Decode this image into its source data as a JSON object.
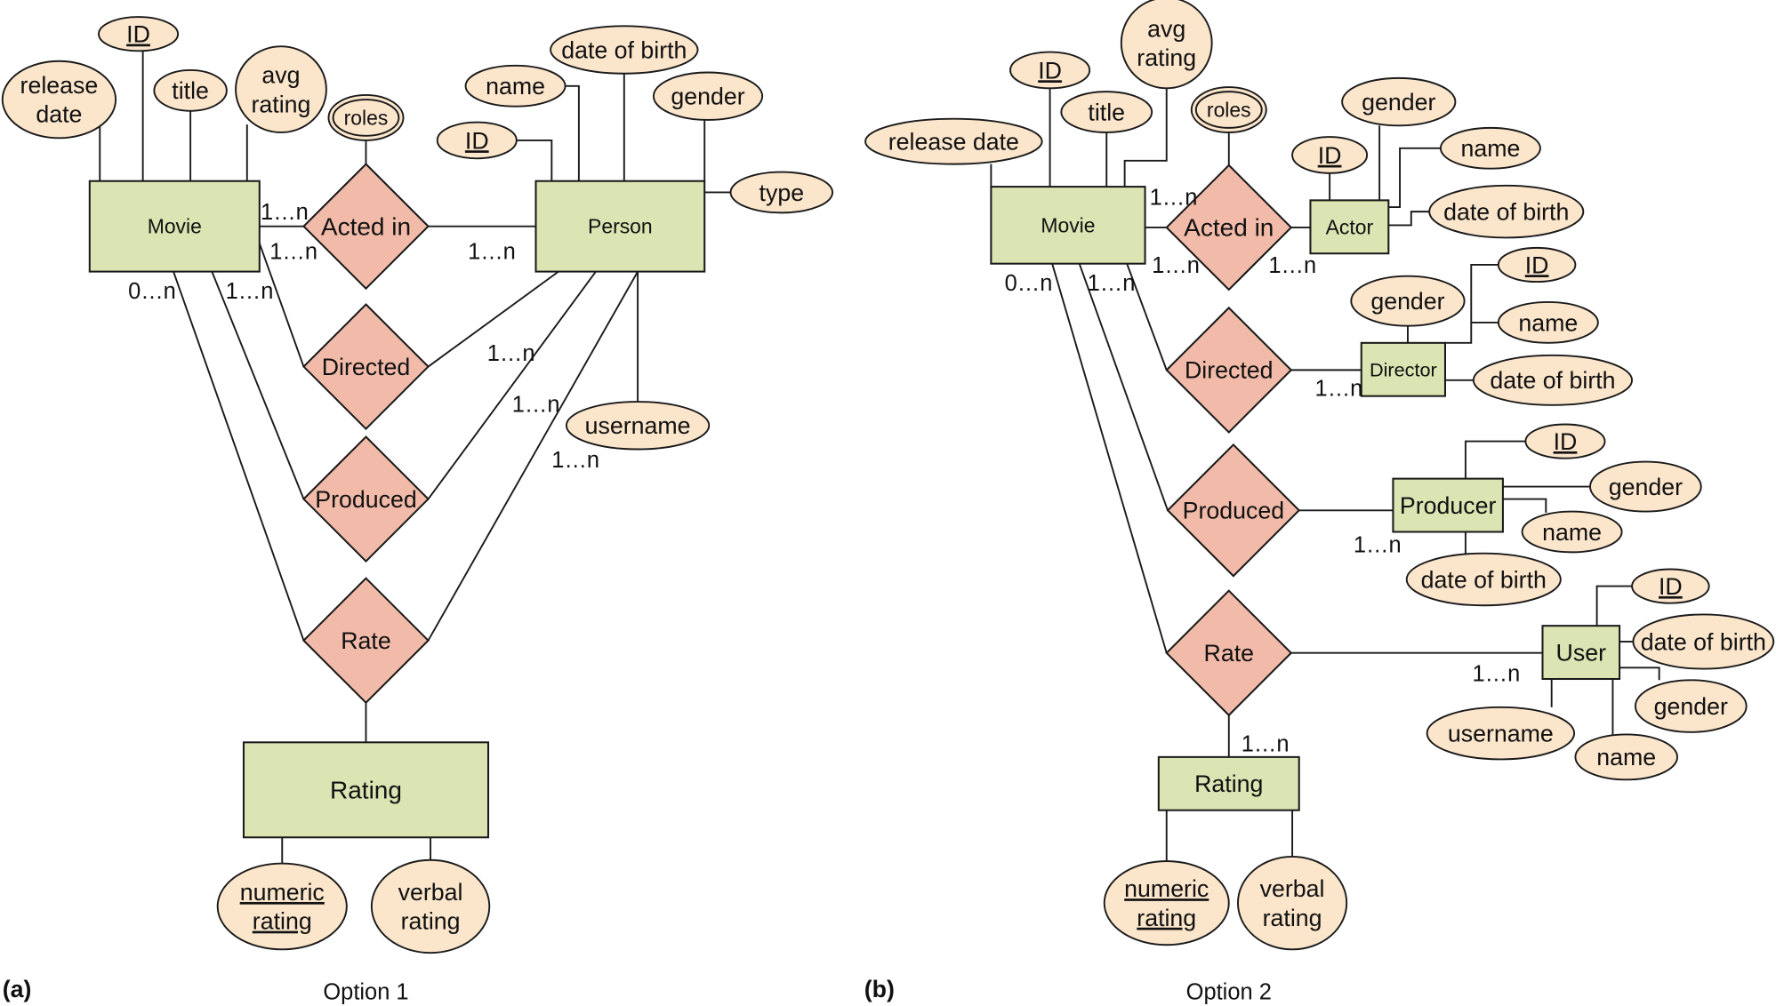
{
  "colors": {
    "entity": "#dbe4b3",
    "relationship": "#f2bba9",
    "attribute": "#fbe5cb",
    "line": "#1a1a1a"
  },
  "captions": {
    "a_label": "(a)",
    "a_title": "Option 1",
    "b_label": "(b)",
    "b_title": "Option 2"
  },
  "nodes": [
    {
      "id": "a_movie",
      "kind": "entity",
      "lines": [
        "Movie"
      ]
    },
    {
      "id": "a_person",
      "kind": "entity",
      "lines": [
        "Person"
      ]
    },
    {
      "id": "a_rating",
      "kind": "entity",
      "lines": [
        "Rating"
      ]
    },
    {
      "id": "a_acted",
      "kind": "relationship",
      "lines": [
        "Acted in"
      ]
    },
    {
      "id": "a_directed",
      "kind": "relationship",
      "lines": [
        "Directed"
      ]
    },
    {
      "id": "a_produced",
      "kind": "relationship",
      "lines": [
        "Produced"
      ]
    },
    {
      "id": "a_rate",
      "kind": "relationship",
      "lines": [
        "Rate"
      ]
    },
    {
      "id": "a_release",
      "kind": "attribute",
      "lines": [
        "release",
        "date"
      ]
    },
    {
      "id": "a_mid",
      "kind": "attribute",
      "key": true,
      "lines": [
        "ID"
      ]
    },
    {
      "id": "a_title",
      "kind": "attribute",
      "lines": [
        "title"
      ]
    },
    {
      "id": "a_avg",
      "kind": "attribute",
      "lines": [
        "avg",
        "rating"
      ]
    },
    {
      "id": "a_roles",
      "kind": "multivalued",
      "lines": [
        "roles"
      ]
    },
    {
      "id": "a_pid",
      "kind": "attribute",
      "key": true,
      "lines": [
        "ID"
      ]
    },
    {
      "id": "a_pname",
      "kind": "attribute",
      "lines": [
        "name"
      ]
    },
    {
      "id": "a_pdob",
      "kind": "attribute",
      "lines": [
        "date of birth"
      ]
    },
    {
      "id": "a_pgender",
      "kind": "attribute",
      "lines": [
        "gender"
      ]
    },
    {
      "id": "a_ptype",
      "kind": "attribute",
      "lines": [
        "type"
      ]
    },
    {
      "id": "a_puser",
      "kind": "attribute",
      "lines": [
        "username"
      ]
    },
    {
      "id": "a_numeric",
      "kind": "attribute",
      "key": true,
      "lines": [
        "numeric",
        "rating"
      ]
    },
    {
      "id": "a_verbal",
      "kind": "attribute",
      "lines": [
        "verbal",
        "rating"
      ]
    },
    {
      "id": "b_movie",
      "kind": "entity",
      "lines": [
        "Movie"
      ]
    },
    {
      "id": "b_actor",
      "kind": "entity",
      "lines": [
        "Actor"
      ]
    },
    {
      "id": "b_director",
      "kind": "entity",
      "lines": [
        "Director"
      ]
    },
    {
      "id": "b_producer",
      "kind": "entity",
      "lines": [
        "Producer"
      ]
    },
    {
      "id": "b_user",
      "kind": "entity",
      "lines": [
        "User"
      ]
    },
    {
      "id": "b_rating",
      "kind": "entity",
      "lines": [
        "Rating"
      ]
    },
    {
      "id": "b_acted",
      "kind": "relationship",
      "lines": [
        "Acted in"
      ]
    },
    {
      "id": "b_directed",
      "kind": "relationship",
      "lines": [
        "Directed"
      ]
    },
    {
      "id": "b_produced",
      "kind": "relationship",
      "lines": [
        "Produced"
      ]
    },
    {
      "id": "b_rate",
      "kind": "relationship",
      "lines": [
        "Rate"
      ]
    },
    {
      "id": "b_release",
      "kind": "attribute",
      "lines": [
        "release date"
      ]
    },
    {
      "id": "b_mid",
      "kind": "attribute",
      "key": true,
      "lines": [
        "ID"
      ]
    },
    {
      "id": "b_title",
      "kind": "attribute",
      "lines": [
        "title"
      ]
    },
    {
      "id": "b_avg",
      "kind": "attribute",
      "lines": [
        "avg",
        "rating"
      ]
    },
    {
      "id": "b_roles",
      "kind": "multivalued",
      "lines": [
        "roles"
      ]
    },
    {
      "id": "b_aid",
      "kind": "attribute",
      "key": true,
      "lines": [
        "ID"
      ]
    },
    {
      "id": "b_agender",
      "kind": "attribute",
      "lines": [
        "gender"
      ]
    },
    {
      "id": "b_aname",
      "kind": "attribute",
      "lines": [
        "name"
      ]
    },
    {
      "id": "b_adob",
      "kind": "attribute",
      "lines": [
        "date of birth"
      ]
    },
    {
      "id": "b_dgender",
      "kind": "attribute",
      "lines": [
        "gender"
      ]
    },
    {
      "id": "b_did",
      "kind": "attribute",
      "key": true,
      "lines": [
        "ID"
      ]
    },
    {
      "id": "b_dname",
      "kind": "attribute",
      "lines": [
        "name"
      ]
    },
    {
      "id": "b_ddob",
      "kind": "attribute",
      "lines": [
        "date of birth"
      ]
    },
    {
      "id": "b_prid",
      "kind": "attribute",
      "key": true,
      "lines": [
        "ID"
      ]
    },
    {
      "id": "b_prgender",
      "kind": "attribute",
      "lines": [
        "gender"
      ]
    },
    {
      "id": "b_prname",
      "kind": "attribute",
      "lines": [
        "name"
      ]
    },
    {
      "id": "b_prdob",
      "kind": "attribute",
      "lines": [
        "date of birth"
      ]
    },
    {
      "id": "b_uid",
      "kind": "attribute",
      "key": true,
      "lines": [
        "ID"
      ]
    },
    {
      "id": "b_udob",
      "kind": "attribute",
      "lines": [
        "date of birth"
      ]
    },
    {
      "id": "b_ugender",
      "kind": "attribute",
      "lines": [
        "gender"
      ]
    },
    {
      "id": "b_uname",
      "kind": "attribute",
      "lines": [
        "name"
      ]
    },
    {
      "id": "b_uuser",
      "kind": "attribute",
      "lines": [
        "username"
      ]
    },
    {
      "id": "b_numeric",
      "kind": "attribute",
      "key": true,
      "lines": [
        "numeric",
        "rating"
      ]
    },
    {
      "id": "b_verbal",
      "kind": "attribute",
      "lines": [
        "verbal",
        "rating"
      ]
    }
  ],
  "cardinalities": [
    "1…n",
    "1…n",
    "1…n",
    "0…n",
    "1…n",
    "1…n",
    "1…n",
    "1…n",
    "1…n",
    "1…n",
    "1…n",
    "0…n",
    "1…n",
    "1…n",
    "1…n",
    "1…n",
    "1…n"
  ]
}
